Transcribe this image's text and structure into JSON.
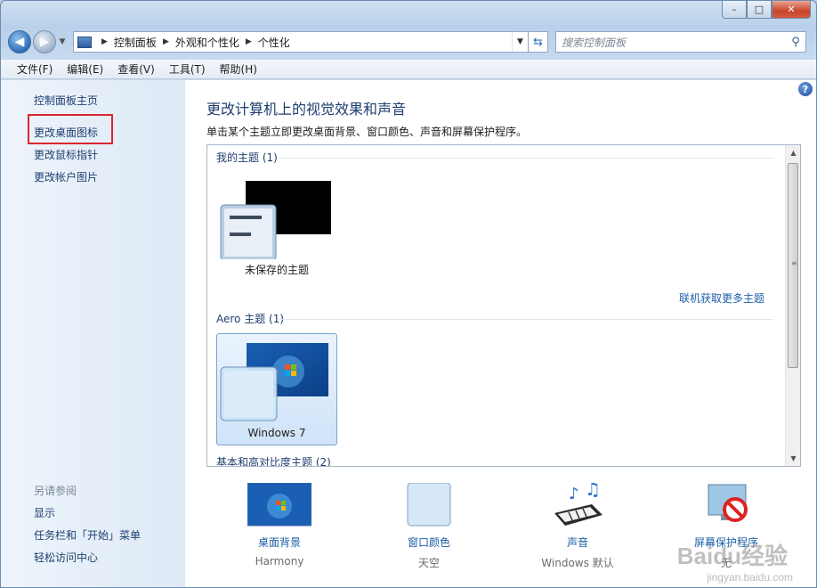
{
  "window": {
    "caption_min": "–",
    "caption_max": "□",
    "caption_close": "✕"
  },
  "address": {
    "crumbs": [
      "控制面板",
      "外观和个性化",
      "个性化"
    ],
    "search_placeholder": "搜索控制面板"
  },
  "menu": [
    "文件(F)",
    "编辑(E)",
    "查看(V)",
    "工具(T)",
    "帮助(H)"
  ],
  "sidebar": {
    "top_links": [
      "控制面板主页",
      "更改桌面图标",
      "更改鼠标指针",
      "更改帐户图片"
    ],
    "see_also_heading": "另请参阅",
    "see_also_links": [
      "显示",
      "任务栏和「开始」菜单",
      "轻松访问中心"
    ]
  },
  "main": {
    "title": "更改计算机上的视觉效果和声音",
    "description": "单击某个主题立即更改桌面背景、窗口颜色、声音和屏幕保护程序。",
    "groups": {
      "my_themes": "我的主题 (1)",
      "aero": "Aero 主题 (1)",
      "basic": "基本和高对比度主题 (2)"
    },
    "themes": {
      "unsaved": "未保存的主题",
      "windows7": "Windows 7"
    },
    "more_themes_link": "联机获取更多主题",
    "help": "?"
  },
  "settings": [
    {
      "label": "桌面背景",
      "value": "Harmony"
    },
    {
      "label": "窗口颜色",
      "value": "天空"
    },
    {
      "label": "声音",
      "value": "Windows 默认"
    },
    {
      "label": "屏幕保护程序",
      "value": "无"
    }
  ],
  "watermark": {
    "main": "Baidu经验",
    "sub": "jingyan.baidu.com"
  },
  "colors": {
    "link": "#1e5fa8",
    "highlight_box": "#d9272e",
    "selected_tile": "#cfe3f8"
  }
}
